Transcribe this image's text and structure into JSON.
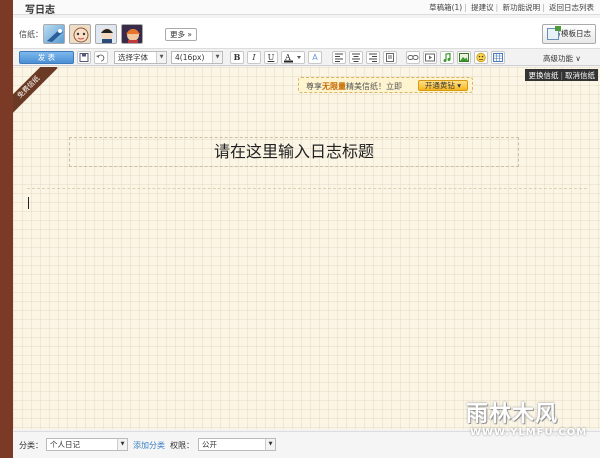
{
  "header": {
    "title": "写日志",
    "links": [
      "草稿箱(1)",
      "提建议",
      "新功能说明",
      "返回日志列表"
    ]
  },
  "paper": {
    "label": "信纸：",
    "thumbs": [
      "paper-1",
      "paper-2",
      "paper-3",
      "paper-4"
    ],
    "more_label": "更多",
    "template_label": "写模板日志"
  },
  "toolbar": {
    "publish_label": "发 表",
    "font_family": "选择字体",
    "font_size": "4(16px)",
    "advanced_label": "高级功能"
  },
  "editor": {
    "ribbon_text": "免费信纸",
    "promo_prefix": "尊享",
    "promo_bold": "无限量",
    "promo_suffix": "精美信纸！立即",
    "promo_button": "开通黄钻",
    "change_paper": "更换信纸",
    "cancel_paper": "取消信纸",
    "title_placeholder": "请在这里输入日志标题"
  },
  "footer": {
    "category_label": "分类：",
    "category_value": "个人日记",
    "add_category": "添加分类",
    "permission_label": "权限：",
    "permission_value": "公开"
  },
  "watermark": {
    "main": "雨林木风",
    "url": "WWW.YLMFU.COM"
  },
  "colors": {
    "sidebar": "#7a3a26",
    "paper_bg": "#fbf5e6",
    "accent_blue": "#4a8fd4",
    "promo_gold": "#f7b820"
  }
}
